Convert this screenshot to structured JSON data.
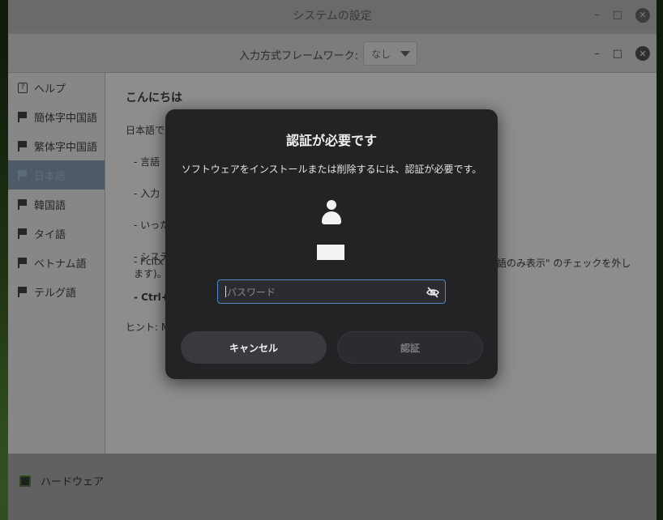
{
  "outer_window": {
    "title": "システムの設定"
  },
  "toolbar": {
    "input_method_label": "入力方式フレームワーク:",
    "input_method_value": "なし"
  },
  "sidebar": {
    "items": [
      {
        "label": "ヘルプ",
        "icon": "help-icon"
      },
      {
        "label": "簡体字中国語",
        "icon": "flag-icon"
      },
      {
        "label": "繁体字中国語",
        "icon": "flag-icon"
      },
      {
        "label": "日本語",
        "icon": "flag-icon",
        "selected": true
      },
      {
        "label": "韓国語",
        "icon": "flag-icon"
      },
      {
        "label": "タイ語",
        "icon": "flag-icon"
      },
      {
        "label": "ベトナム語",
        "icon": "flag-icon"
      },
      {
        "label": "テルグ語",
        "icon": "flag-icon"
      }
    ]
  },
  "content": {
    "heading": "こんにちは",
    "lines": [
      "日本語で",
      "- 言語",
      "- 入力",
      "- いった",
      "- システ"
    ],
    "fcitx_text": "- Fcitx",
    "fcitx_line2": "ます)。",
    "fcitx_tail": "言語のみ表示\" のチェックを外し",
    "ctrl_text": "- Ctrl+",
    "hint": "ヒント: M"
  },
  "bottom": {
    "hardware_label": "ハードウェア"
  },
  "dialog": {
    "title": "認証が必要です",
    "message": "ソフトウェアをインストールまたは削除するには、認証が必要です。",
    "password_placeholder": "パスワード",
    "cancel_label": "キャンセル",
    "auth_label": "認証"
  },
  "colors": {
    "dialog_bg": "#232326",
    "focus_border": "#4a8cc8",
    "selected_bg": "#4e5a66"
  }
}
